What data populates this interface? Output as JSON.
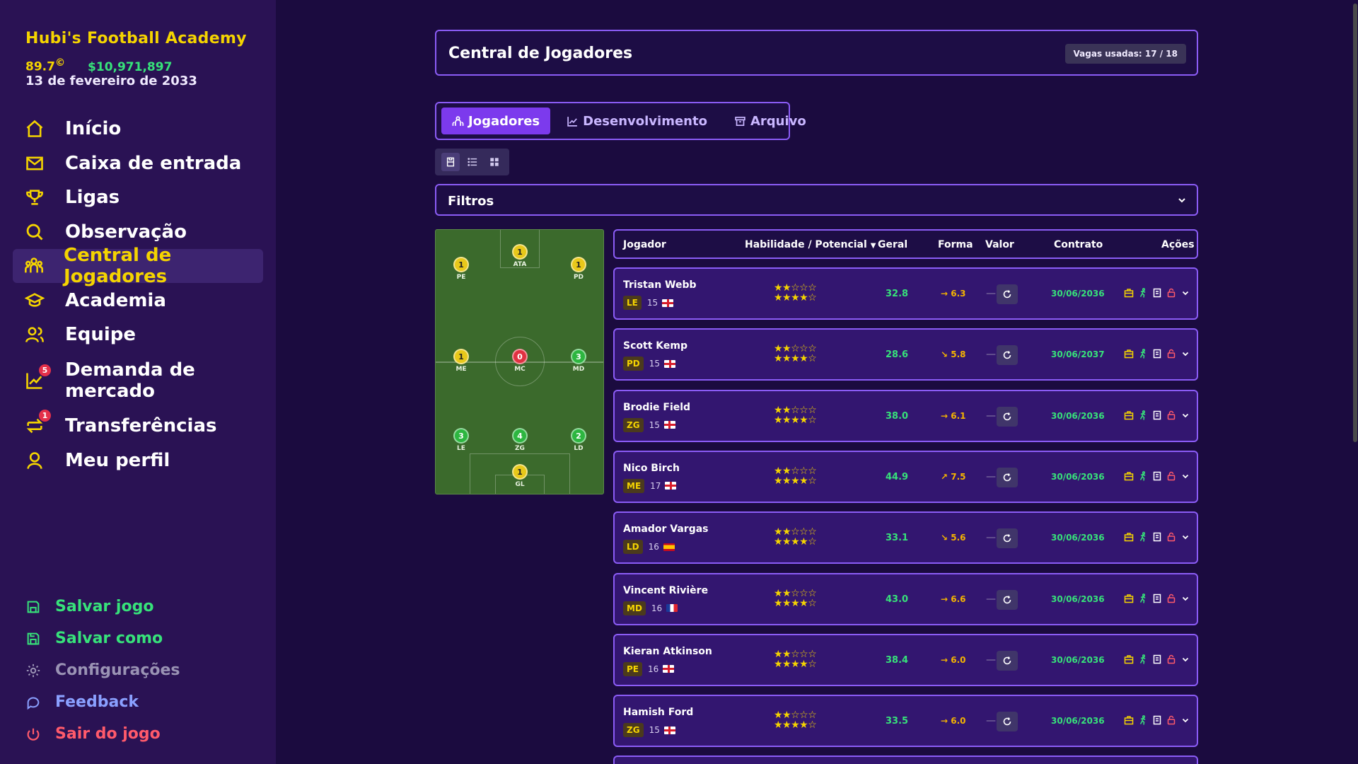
{
  "sidebar": {
    "academy_name": "Hubi's Football Academy",
    "rating": "89.7",
    "rating_icon": "©",
    "money": "$10,971,897",
    "date": "13 de fevereiro de 2033",
    "nav": [
      {
        "label": "Início",
        "icon": "home-icon"
      },
      {
        "label": "Caixa de entrada",
        "icon": "mail-icon"
      },
      {
        "label": "Ligas",
        "icon": "trophy-icon"
      },
      {
        "label": "Observação",
        "icon": "search-icon"
      },
      {
        "label": "Central de Jogadores",
        "icon": "players-icon",
        "active": true
      },
      {
        "label": "Academia",
        "icon": "graduation-cap-icon"
      },
      {
        "label": "Equipe",
        "icon": "staff-icon"
      },
      {
        "label": "Demanda de mercado",
        "icon": "chart-icon",
        "badge": "5"
      },
      {
        "label": "Transferências",
        "icon": "transfer-icon",
        "badge": "1"
      },
      {
        "label": "Meu perfil",
        "icon": "user-icon"
      }
    ],
    "bottom": [
      {
        "label": "Salvar jogo",
        "icon": "save-icon",
        "color": "#37e27a"
      },
      {
        "label": "Salvar como",
        "icon": "save-as-icon",
        "color": "#37e27a"
      },
      {
        "label": "Configurações",
        "icon": "gear-icon",
        "color": "#9a93b4"
      },
      {
        "label": "Feedback",
        "icon": "feedback-icon",
        "color": "#8aa0ff"
      },
      {
        "label": "Sair do jogo",
        "icon": "power-icon",
        "color": "#ff5a6b"
      }
    ]
  },
  "header": {
    "title": "Central de Jogadores",
    "slots": "Vagas usadas: 17 / 18"
  },
  "tabs": [
    {
      "label": "Jogadores",
      "active": true
    },
    {
      "label": "Desenvolvimento"
    },
    {
      "label": "Arquivo"
    }
  ],
  "filters": {
    "label": "Filtros"
  },
  "pitch": {
    "positions": [
      {
        "label": "ATA",
        "count": "1",
        "color": "yellow"
      },
      {
        "label": "PE",
        "count": "1",
        "color": "yellow"
      },
      {
        "label": "PD",
        "count": "1",
        "color": "yellow"
      },
      {
        "label": "ME",
        "count": "1",
        "color": "yellow"
      },
      {
        "label": "MC",
        "count": "0",
        "color": "red"
      },
      {
        "label": "MD",
        "count": "3",
        "color": "green"
      },
      {
        "label": "LE",
        "count": "3",
        "color": "green"
      },
      {
        "label": "ZG",
        "count": "4",
        "color": "green"
      },
      {
        "label": "LD",
        "count": "2",
        "color": "green"
      },
      {
        "label": "GL",
        "count": "1",
        "color": "yellow"
      }
    ]
  },
  "table": {
    "headers": {
      "player": "Jogador",
      "skill": "Habilidade / Potencial",
      "overall": "Geral",
      "form": "Forma",
      "value": "Valor",
      "contract": "Contrato",
      "actions": "Ações"
    },
    "rows": [
      {
        "name": "Tristan Webb",
        "pos": "LE",
        "age": "15",
        "flag": "eng",
        "skill_stars": "★★☆☆☆",
        "pot_stars": "★★★★☆",
        "overall": "32.8",
        "form_arrow": "→",
        "form": "6.3",
        "value": "—",
        "contract": "30/06/2036"
      },
      {
        "name": "Scott Kemp",
        "pos": "PD",
        "age": "15",
        "flag": "eng",
        "skill_stars": "★★☆☆☆",
        "pot_stars": "★★★★☆",
        "overall": "28.6",
        "form_arrow": "↘",
        "form": "5.8",
        "value": "—",
        "contract": "30/06/2037"
      },
      {
        "name": "Brodie Field",
        "pos": "ZG",
        "age": "15",
        "flag": "eng",
        "skill_stars": "★★☆☆☆",
        "pot_stars": "★★★★☆",
        "overall": "38.0",
        "form_arrow": "→",
        "form": "6.1",
        "value": "—",
        "contract": "30/06/2036"
      },
      {
        "name": "Nico Birch",
        "pos": "ME",
        "age": "17",
        "flag": "eng",
        "skill_stars": "★★☆☆☆",
        "pot_stars": "★★★★☆",
        "overall": "44.9",
        "form_arrow": "↗",
        "form": "7.5",
        "value": "—",
        "contract": "30/06/2036"
      },
      {
        "name": "Amador Vargas",
        "pos": "LD",
        "age": "16",
        "flag": "esp",
        "skill_stars": "★★☆☆☆",
        "pot_stars": "★★★★☆",
        "overall": "33.1",
        "form_arrow": "↘",
        "form": "5.6",
        "value": "—",
        "contract": "30/06/2036"
      },
      {
        "name": "Vincent Rivière",
        "pos": "MD",
        "age": "16",
        "flag": "fra",
        "skill_stars": "★★☆☆☆",
        "pot_stars": "★★★★☆",
        "overall": "43.0",
        "form_arrow": "→",
        "form": "6.6",
        "value": "—",
        "contract": "30/06/2036"
      },
      {
        "name": "Kieran Atkinson",
        "pos": "PE",
        "age": "16",
        "flag": "eng",
        "skill_stars": "★★☆☆☆",
        "pot_stars": "★★★★☆",
        "overall": "38.4",
        "form_arrow": "→",
        "form": "6.0",
        "value": "—",
        "contract": "30/06/2036"
      },
      {
        "name": "Hamish Ford",
        "pos": "ZG",
        "age": "15",
        "flag": "eng",
        "skill_stars": "★★☆☆☆",
        "pot_stars": "★★★★☆",
        "overall": "33.5",
        "form_arrow": "→",
        "form": "6.0",
        "value": "—",
        "contract": "30/06/2036"
      }
    ]
  },
  "colors": {
    "accent": "#8b5cf6",
    "yellow": "#f5d400",
    "green": "#37e27a",
    "background": "#1b0b3f",
    "sidebar": "#2a1254"
  }
}
